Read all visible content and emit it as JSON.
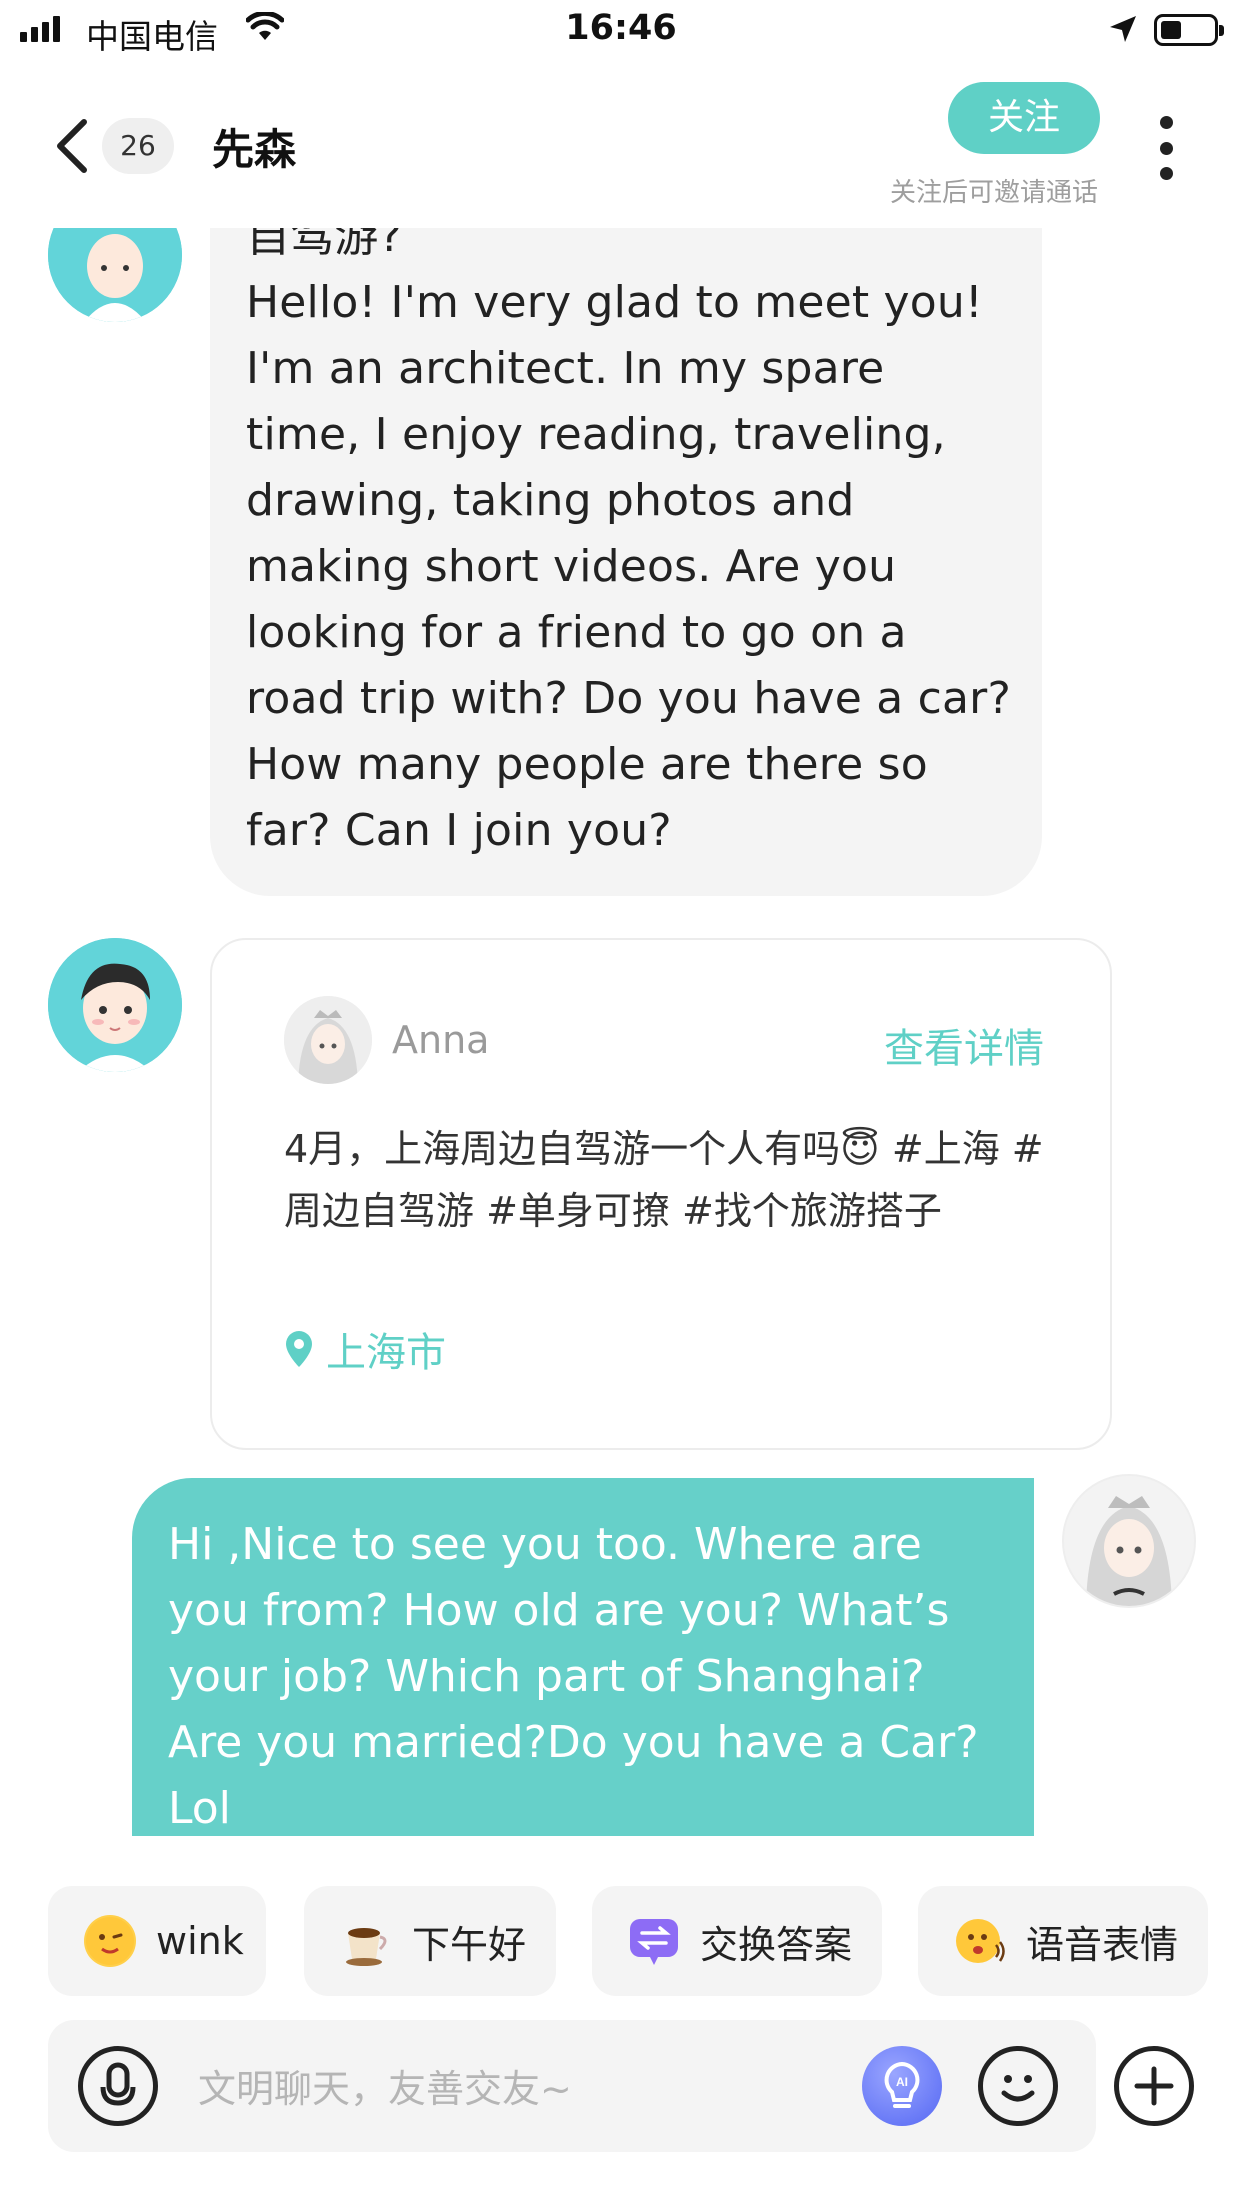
{
  "status_bar": {
    "carrier": "中国电信",
    "time": "16:46"
  },
  "header": {
    "unread_count": "26",
    "contact_name": "先森",
    "follow_label": "关注",
    "follow_hint": "关注后可邀请通话"
  },
  "messages": {
    "incoming_partial_line": "自驾游?",
    "incoming_text": "Hello! I'm very glad to meet you! I'm an architect. In my spare time, I enjoy reading, traveling, drawing, taking photos and making short videos. Are you looking for a friend to go on a road trip with? Do you have a car? How many people are there so far? Can I join you?",
    "card": {
      "author": "Anna",
      "detail_link": "查看详情",
      "text": "4月，上海周边自驾游一个人有吗😇 #上海 #周边自驾游 #单身可撩 #找个旅游搭子",
      "location": "上海市"
    },
    "outgoing_text": "Hi ,Nice to see you too. Where are you from?  How old are you? What’s your job? Which part of Shanghai? Are you married?Do you have a Car? Lol"
  },
  "quick_replies": [
    {
      "label": "wink",
      "icon": "wink-emoji-icon"
    },
    {
      "label": "下午好",
      "icon": "coffee-cup-icon"
    },
    {
      "label": "交换答案",
      "icon": "exchange-icon"
    },
    {
      "label": "语音表情",
      "icon": "voice-emoji-icon"
    }
  ],
  "input": {
    "placeholder": "文明聊天，友善交友~"
  },
  "colors": {
    "accent": "#5fd0c6",
    "outgoing_bubble": "#66d0c9",
    "incoming_bubble": "#f4f4f4",
    "ai_button": "#5467f3"
  }
}
